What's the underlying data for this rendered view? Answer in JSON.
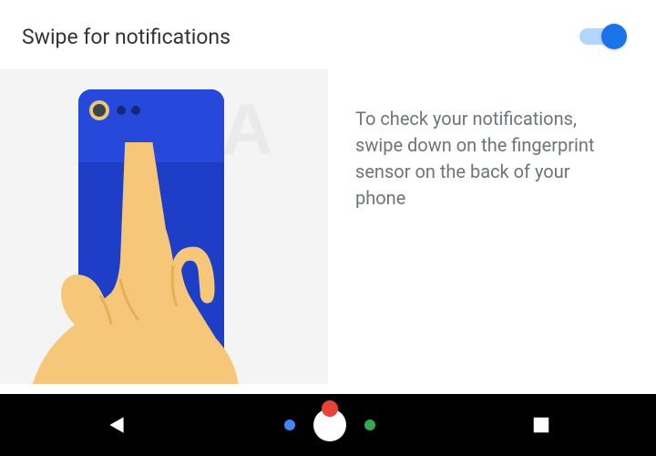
{
  "header": {
    "title": "Swipe for notifications",
    "toggle_state": "on"
  },
  "description": "To check your notifications, swipe down on the fingerprint sensor on the back of your phone",
  "colors": {
    "accent": "#1a73e8",
    "phone_body": "#1f3ec7",
    "hand": "#f6c778"
  }
}
